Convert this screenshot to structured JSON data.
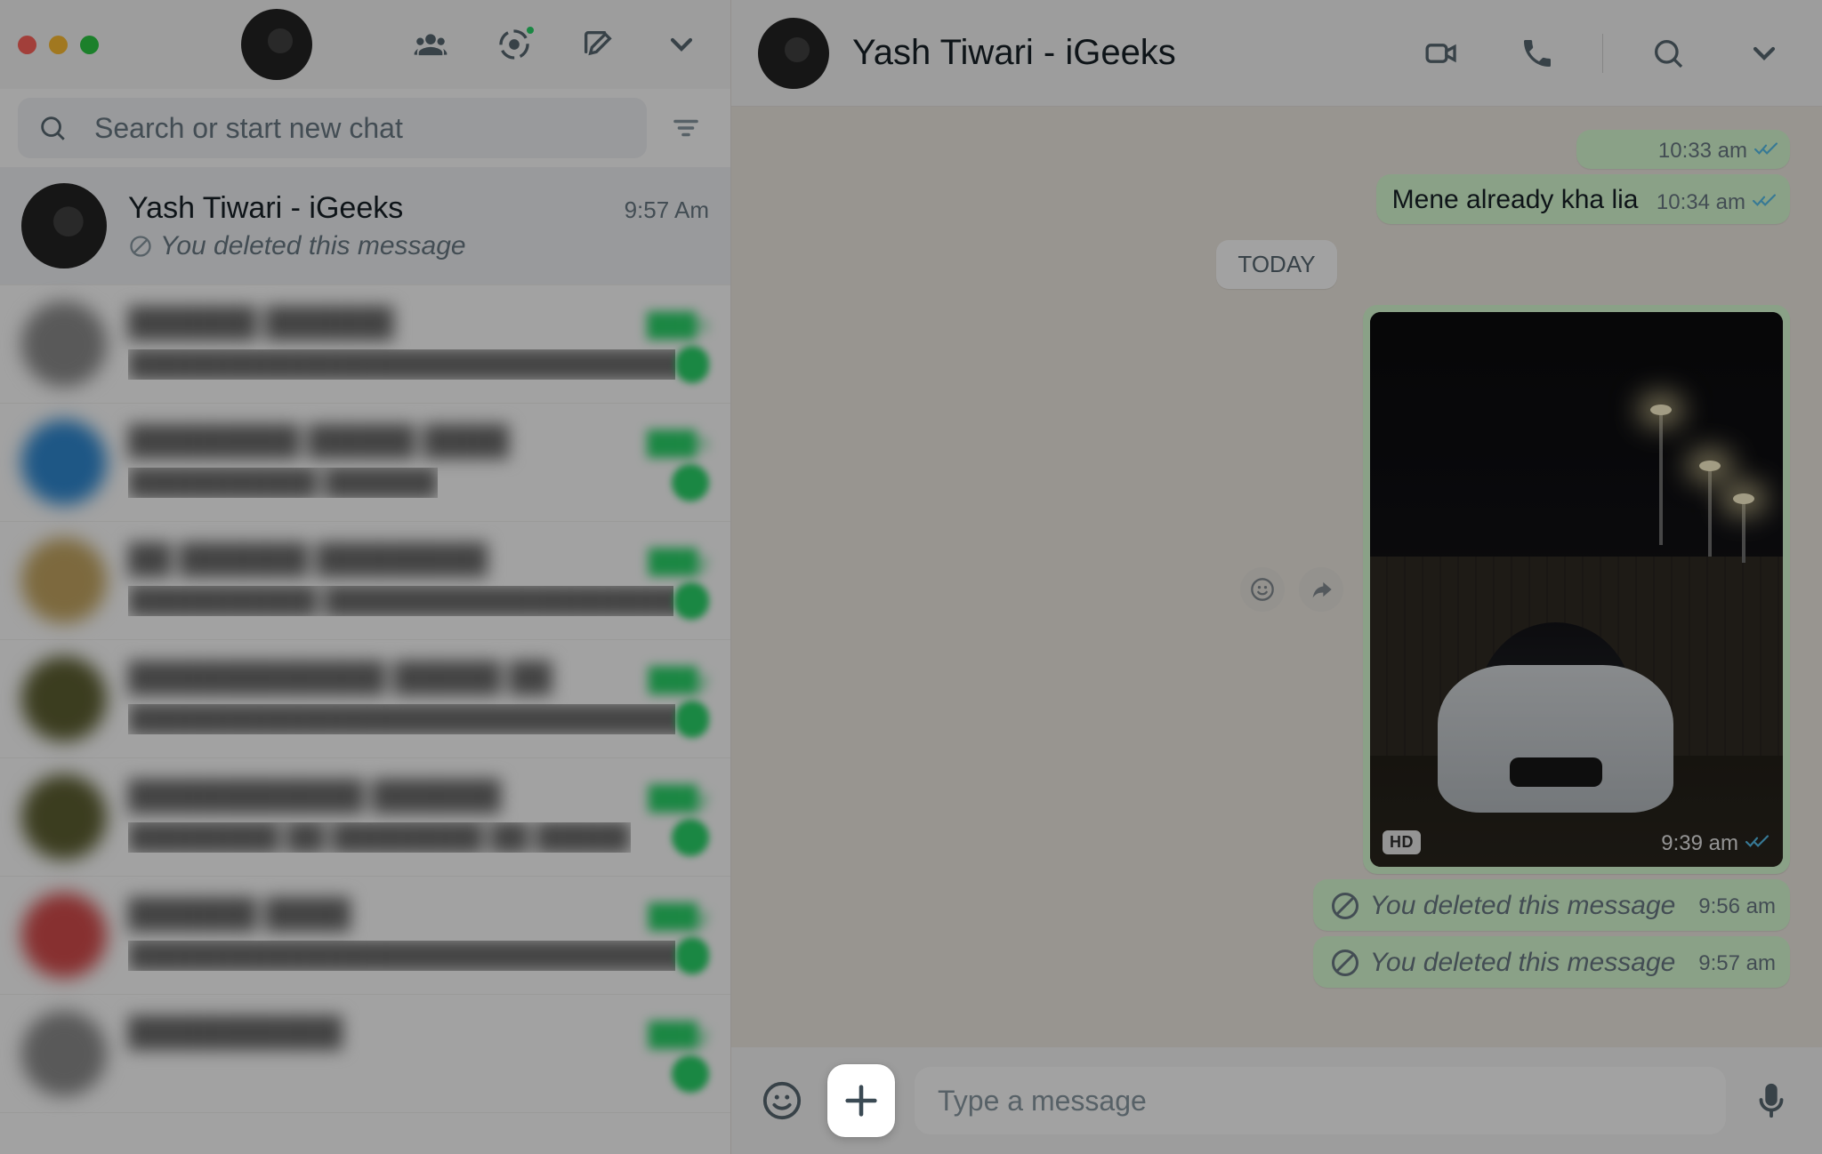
{
  "sidebar": {
    "search_placeholder": "Search or start new chat"
  },
  "chats": [
    {
      "name": "Yash Tiwari - iGeeks",
      "time": "9:57 Am",
      "preview": "You deleted this message",
      "active": true,
      "deleted_icon": true,
      "av": "av-bike"
    },
    {
      "name": "██████ ██████",
      "time": "███n",
      "preview": "████████████████████████████████",
      "blur": true,
      "av": "av-gray"
    },
    {
      "name": "████████ █████ ████",
      "time": "███n",
      "preview": "██████████ ██████",
      "blur": true,
      "av": "av-blue"
    },
    {
      "name": "██ ██████ ████████",
      "time": "███y",
      "preview": "██████████ ████████████████████",
      "blur": true,
      "av": "av-tan"
    },
    {
      "name": "████████████ █████ ██",
      "time": "███y",
      "preview": "████████████████████████████████",
      "blur": true,
      "av": "av-olive"
    },
    {
      "name": "███████████ ██████",
      "time": "███y",
      "preview": "████████ ██ ████████ ██ █████",
      "blur": true,
      "av": "av-olive"
    },
    {
      "name": "██████ ████",
      "time": "███y",
      "preview": "████████████████████████████████",
      "blur": true,
      "av": "av-red"
    },
    {
      "name": "██████████",
      "time": "███y",
      "preview": "",
      "blur": true,
      "av": "av-gray"
    }
  ],
  "conversation": {
    "title": "Yash Tiwari - iGeeks",
    "prev_msg_time": "10:33 am",
    "msg1_text": "Mene already kha lia",
    "msg1_time": "10:34 am",
    "date_chip": "TODAY",
    "image_time": "9:39 am",
    "hd_label": "HD",
    "deleted1_text": "You deleted this message",
    "deleted1_time": "9:56 am",
    "deleted2_text": "You deleted this message",
    "deleted2_time": "9:57 am"
  },
  "composer": {
    "placeholder": "Type a message"
  }
}
